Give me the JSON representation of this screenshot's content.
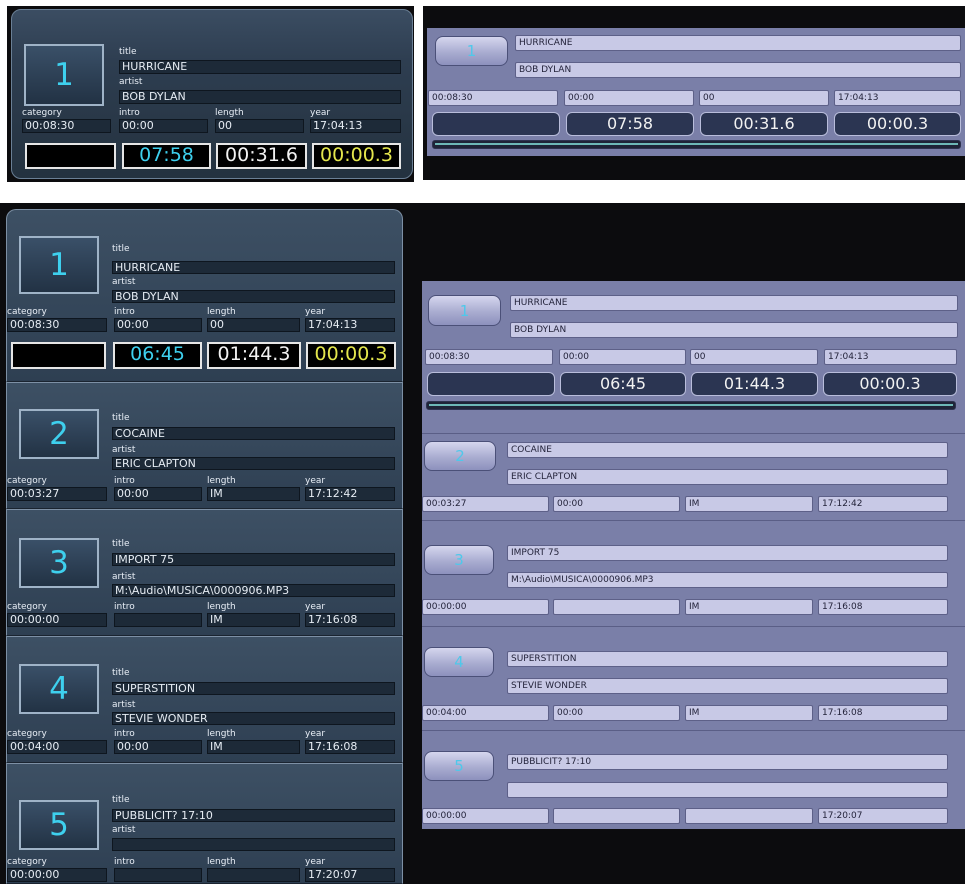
{
  "labels": {
    "title": "title",
    "artist": "artist",
    "category": "category",
    "intro": "intro",
    "length": "length",
    "year": "year"
  },
  "top_dark": {
    "number": "1",
    "title": "HURRICANE",
    "artist": "BOB DYLAN",
    "category": "00:08:30",
    "intro": "00:00",
    "length": "00",
    "year": "17:04:13",
    "timer_remaining": "07:58",
    "timer_elapsed": "00:31.6",
    "timer_intro": "00:00.3"
  },
  "top_light": {
    "number": "1",
    "title": "HURRICANE",
    "artist": "BOB DYLAN",
    "category": "00:08:30",
    "intro": "00:00",
    "length": "00",
    "year": "17:04:13",
    "timer_remaining": "07:58",
    "timer_elapsed": "00:31.6",
    "timer_intro": "00:00.3"
  },
  "dark_list": [
    {
      "number": "1",
      "title": "HURRICANE",
      "artist": "BOB DYLAN",
      "category": "00:08:30",
      "intro": "00:00",
      "length": "00",
      "year": "17:04:13",
      "timer_remaining": "06:45",
      "timer_elapsed": "01:44.3",
      "timer_intro": "00:00.3"
    },
    {
      "number": "2",
      "title": "COCAINE",
      "artist": "ERIC CLAPTON",
      "category": "00:03:27",
      "intro": "00:00",
      "length": "IM",
      "year": "17:12:42"
    },
    {
      "number": "3",
      "title": "IMPORT 75",
      "artist": "M:\\Audio\\MUSICA\\0000906.MP3",
      "category": "00:00:00",
      "intro": "",
      "length": "IM",
      "year": "17:16:08"
    },
    {
      "number": "4",
      "title": "SUPERSTITION",
      "artist": "STEVIE WONDER",
      "category": "00:04:00",
      "intro": "00:00",
      "length": "IM",
      "year": "17:16:08"
    },
    {
      "number": "5",
      "title": "PUBBLICIT? 17:10",
      "artist": "",
      "category": "00:00:00",
      "intro": "",
      "length": "",
      "year": "17:20:07"
    }
  ],
  "light_list": [
    {
      "number": "1",
      "title": "HURRICANE",
      "artist": "BOB DYLAN",
      "category": "00:08:30",
      "intro": "00:00",
      "length": "00",
      "year": "17:04:13",
      "timer_remaining": "06:45",
      "timer_elapsed": "01:44.3",
      "timer_intro": "00:00.3"
    },
    {
      "number": "2",
      "title": "COCAINE",
      "artist": "ERIC CLAPTON",
      "category": "00:03:27",
      "intro": "00:00",
      "length": "IM",
      "year": "17:12:42"
    },
    {
      "number": "3",
      "title": "IMPORT 75",
      "artist": "M:\\Audio\\MUSICA\\0000906.MP3",
      "category": "00:00:00",
      "intro": "",
      "length": "IM",
      "year": "17:16:08"
    },
    {
      "number": "4",
      "title": "SUPERSTITION",
      "artist": "STEVIE WONDER",
      "category": "00:04:00",
      "intro": "00:00",
      "length": "IM",
      "year": "17:16:08"
    },
    {
      "number": "5",
      "title": "PUBBLICIT? 17:10",
      "artist": "",
      "category": "00:00:00",
      "intro": "",
      "length": "",
      "year": "17:20:07"
    }
  ],
  "colors": {
    "dark_background": "#0c0c0e",
    "dark_panel": "#2e3e51",
    "light_panel": "#7a7fa8",
    "light_field": "#c8c9e6",
    "number_cyan": "#3ed0ee",
    "timer_cyan": "#3ed0ee",
    "timer_yellow": "#e4e64c"
  }
}
